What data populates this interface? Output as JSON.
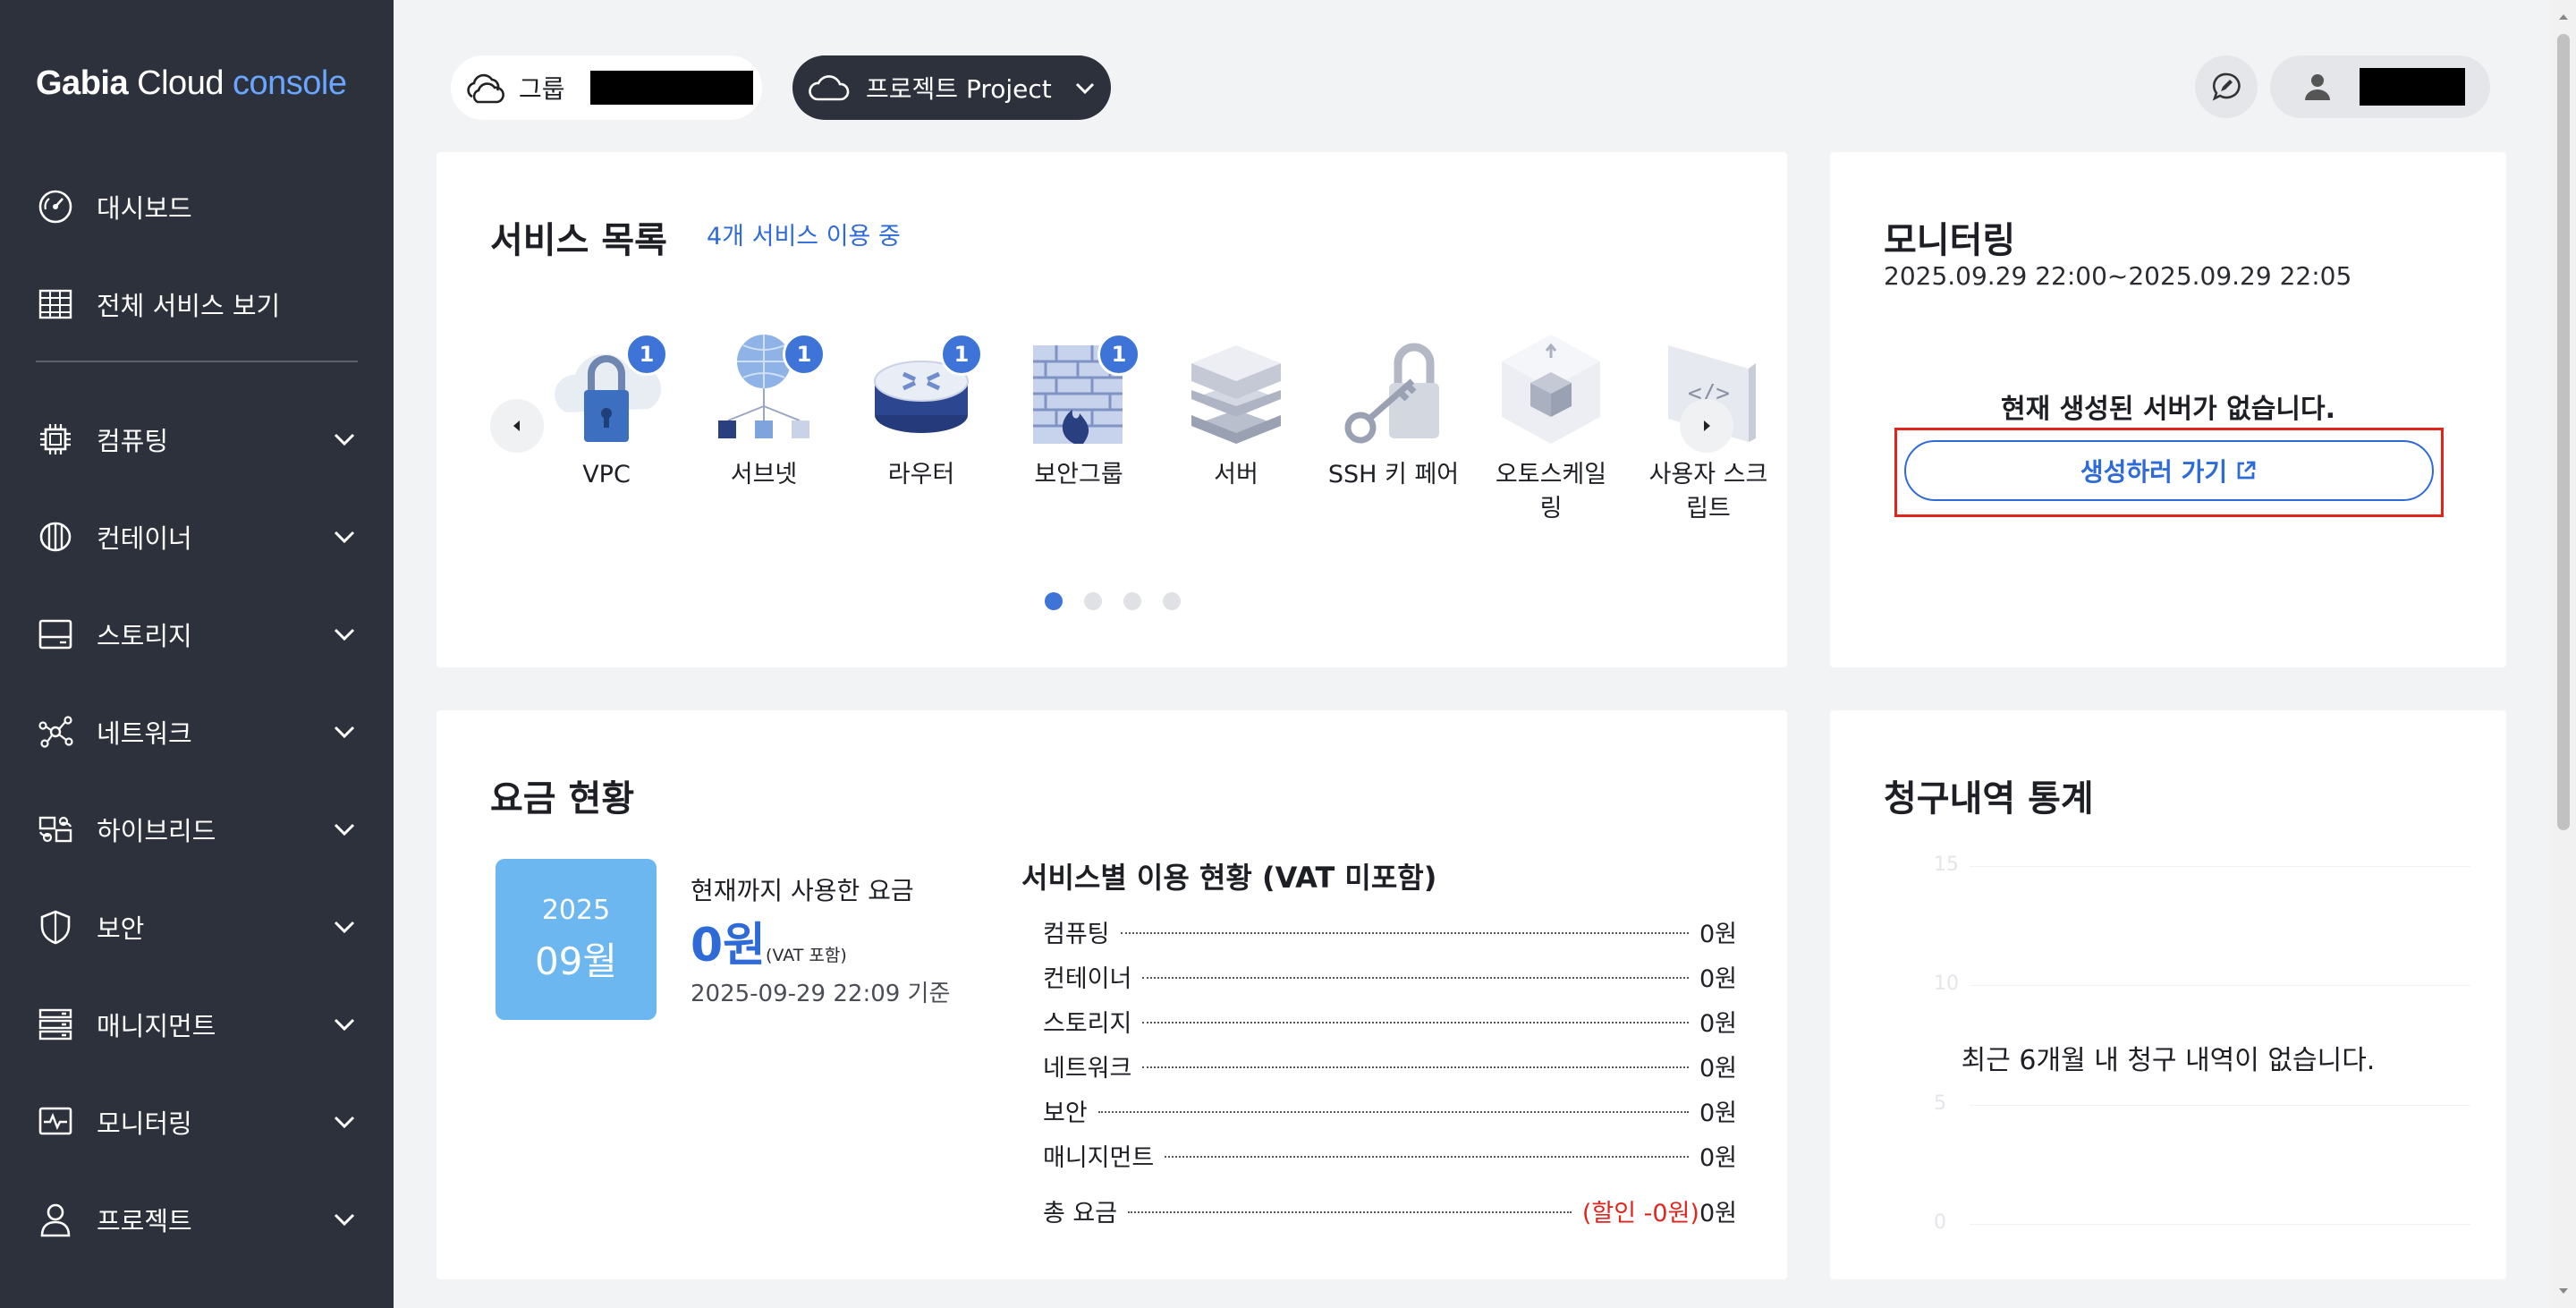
{
  "sidebar": {
    "logo": {
      "brand": "Gabia",
      "product": "Cloud",
      "suffix": "console"
    },
    "top_items": [
      {
        "label": "대시보드",
        "icon": "dashboard-gauge-icon"
      },
      {
        "label": "전체 서비스 보기",
        "icon": "grid-table-icon"
      }
    ],
    "groups": [
      {
        "label": "컴퓨팅",
        "icon": "cpu-chip-icon"
      },
      {
        "label": "컨테이너",
        "icon": "container-icon"
      },
      {
        "label": "스토리지",
        "icon": "storage-drive-icon"
      },
      {
        "label": "네트워크",
        "icon": "network-nodes-icon"
      },
      {
        "label": "하이브리드",
        "icon": "hybrid-icon"
      },
      {
        "label": "보안",
        "icon": "shield-icon"
      },
      {
        "label": "매니지먼트",
        "icon": "management-rack-icon"
      },
      {
        "label": "모니터링",
        "icon": "monitoring-pulse-icon"
      },
      {
        "label": "프로젝트",
        "icon": "user-person-icon"
      }
    ]
  },
  "topbar": {
    "group_label": "그룹",
    "project_label": "프로젝트 Project"
  },
  "services": {
    "title": "서비스 목록",
    "count_text": "4개 서비스 이용 중",
    "items": [
      {
        "name": "VPC",
        "badge": "1",
        "icon": "vpc-lock-cloud-icon"
      },
      {
        "name": "서브넷",
        "badge": "1",
        "icon": "subnet-globe-icon"
      },
      {
        "name": "라우터",
        "badge": "1",
        "icon": "router-icon"
      },
      {
        "name": "보안그룹",
        "badge": "1",
        "icon": "firewall-icon"
      },
      {
        "name": "서버",
        "badge": "",
        "icon": "server-stack-icon"
      },
      {
        "name": "SSH 키 페어",
        "badge": "",
        "icon": "key-lock-icon"
      },
      {
        "name": "오토스케일\n링",
        "badge": "",
        "icon": "autoscaling-cube-icon"
      },
      {
        "name": "사용자 스크\n립트",
        "badge": "",
        "icon": "user-script-icon"
      }
    ],
    "pages": 4,
    "current_page": 1
  },
  "monitoring": {
    "title": "모니터링",
    "range": "2025.09.29 22:00~2025.09.29 22:05",
    "empty_text": "현재 생성된 서버가 없습니다.",
    "create_label": "생성하러 가기"
  },
  "fee": {
    "title": "요금 현황",
    "year": "2025",
    "month": "09월",
    "used_label": "현재까지 사용한 요금",
    "used_amount": "0원",
    "vat_note": "(VAT 포함)",
    "as_of": "2025-09-29 22:09 기준",
    "usage_title": "서비스별 이용 현황 (VAT 미포함)",
    "rows": [
      {
        "name": "컴퓨팅",
        "amount": "0원"
      },
      {
        "name": "컨테이너",
        "amount": "0원"
      },
      {
        "name": "스토리지",
        "amount": "0원"
      },
      {
        "name": "네트워크",
        "amount": "0원"
      },
      {
        "name": "보안",
        "amount": "0원"
      },
      {
        "name": "매니지먼트",
        "amount": "0원"
      }
    ],
    "total_label": "총 요금",
    "total_discount": "(할인 -0원)",
    "total_amount": "0원"
  },
  "billing": {
    "title": "청구내역 통계",
    "empty_text": "최근 6개월 내 청구 내역이 없습니다.",
    "y_ticks": [
      "15",
      "10",
      "5",
      "0"
    ]
  }
}
